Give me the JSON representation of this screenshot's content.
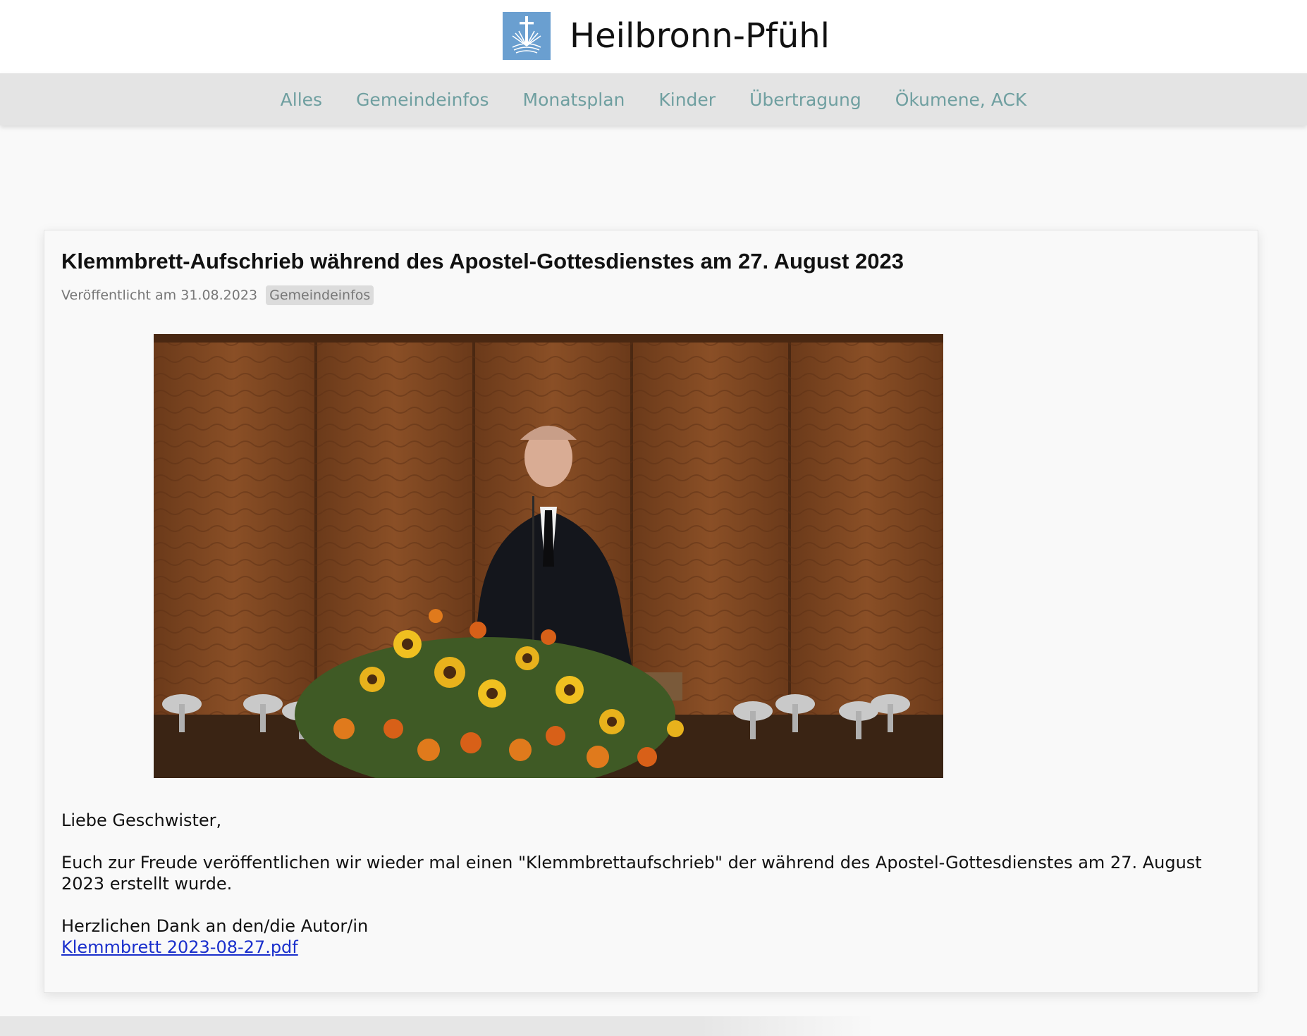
{
  "header": {
    "site_title": "Heilbronn-Pfühl",
    "logo_icon": "cross-sunrise-icon",
    "logo_color": "#6a9fd0"
  },
  "nav": {
    "items": [
      {
        "label": "Alles"
      },
      {
        "label": "Gemeindeinfos"
      },
      {
        "label": "Monatsplan"
      },
      {
        "label": "Kinder"
      },
      {
        "label": "Übertragung"
      },
      {
        "label": "Ökumene, ACK"
      }
    ],
    "link_color": "#6f9fa0"
  },
  "post": {
    "title": "Klemmbrett-Aufschrieb während des Apostel-Gottesdienstes am 27. August 2023",
    "published_prefix": "Veröffentlicht am",
    "published_date": "31.08.2023",
    "category": "Gemeindeinfos",
    "greeting": "Liebe Geschwister,",
    "paragraph": "Euch zur Freude veröffentlichen wir wieder mal einen \"Klemmbrettaufschrieb\" der während des Apostel-Gottesdienstes am 27. August 2023 erstellt wurde.",
    "thanks": "Herzlichen Dank an den/die Autor/in",
    "attachment_link": "Klemmbrett 2023-08-27.pdf",
    "link_color": "#1a2fcc"
  }
}
